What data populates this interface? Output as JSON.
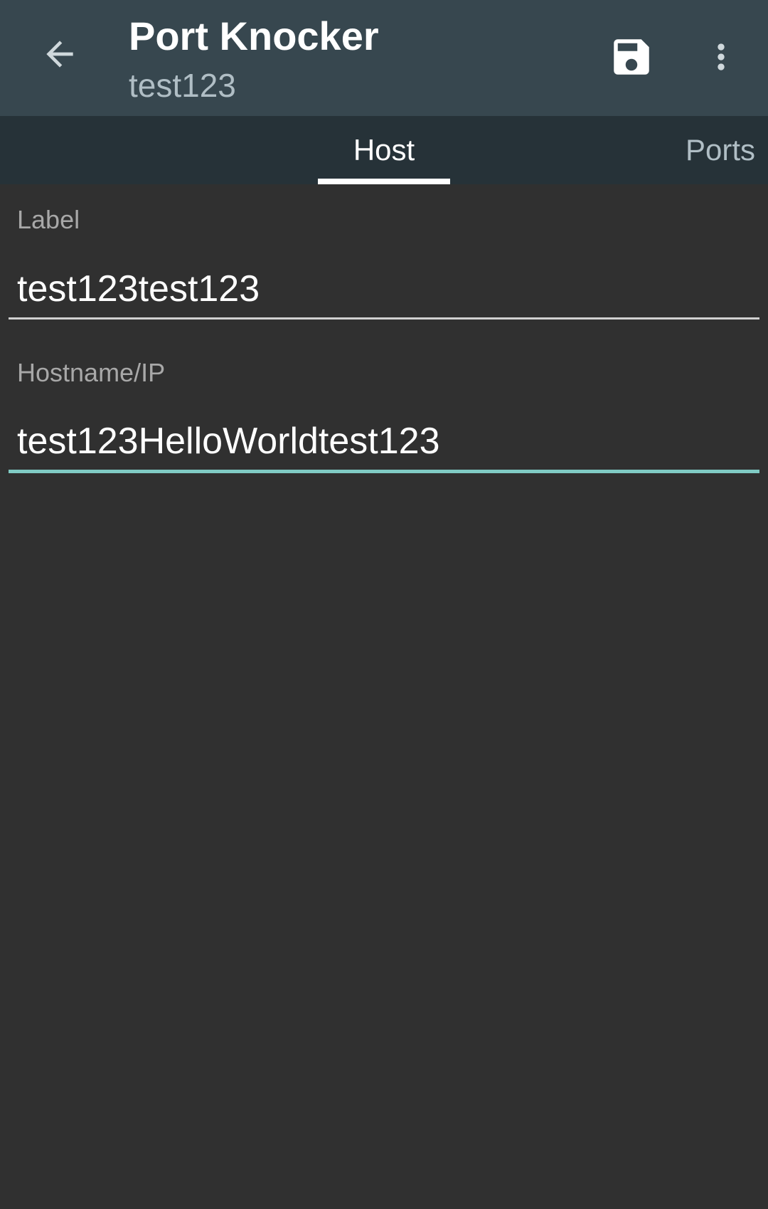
{
  "toolbar": {
    "title": "Port Knocker",
    "subtitle": "test123",
    "icons": {
      "back": "arrow-back-icon",
      "save": "save-icon",
      "more": "more-vert-icon"
    }
  },
  "tabs": [
    {
      "label": "Host",
      "selected": true
    },
    {
      "label": "Ports",
      "selected": false
    }
  ],
  "form": {
    "label_field": {
      "label": "Label",
      "value": "test123test123"
    },
    "host_field": {
      "label": "Hostname/IP",
      "value": "test123HelloWorldtest123",
      "focused": true
    }
  },
  "colors": {
    "toolbar_bg": "#37474f",
    "tabbar_bg": "#263238",
    "content_bg": "#303030",
    "accent": "#80cbc4"
  }
}
